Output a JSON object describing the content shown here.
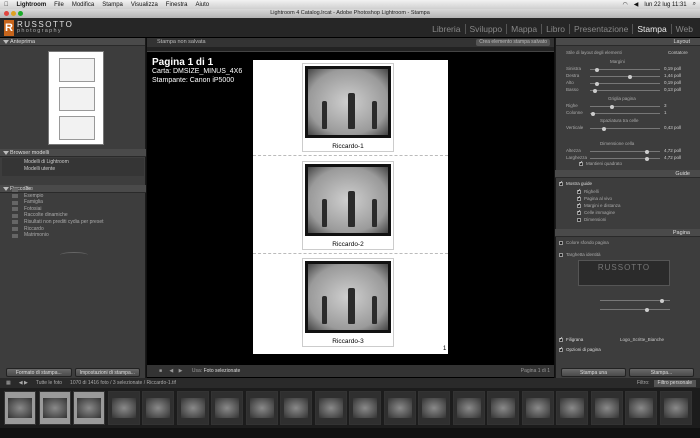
{
  "macbar": {
    "app": "Lightroom",
    "menus": [
      "File",
      "Modifica",
      "Stampa",
      "Visualizza",
      "Finestra",
      "Aiuto"
    ],
    "clock": "lun 22 lug  11:31"
  },
  "window": {
    "title": "Lightroom 4 Catalog.lrcat - Adobe Photoshop Lightroom - Stampa"
  },
  "identity": {
    "brand_letter": "R",
    "brand_name": "RUSSOTTO",
    "brand_sub": "photography"
  },
  "modules": [
    "Libreria",
    "Sviluppo",
    "Mappa",
    "Libro",
    "Presentazione",
    "Stampa",
    "Web"
  ],
  "active_module": "Stampa",
  "left": {
    "preview_header": "Anteprima",
    "template_header": "Browser modelli",
    "templates": [
      "Modelli di Lightroom",
      "Modelli utente"
    ],
    "collections_header": "Raccolte",
    "collections": [
      "Ciro",
      "Esempio",
      "Famiglia",
      "Fotosiai",
      "Raccolte dinamiche",
      "Risultati non prediti cydia per preset",
      "Riccardo",
      "Matrimonio"
    ],
    "page_setup_btn": "Formato di stampa...",
    "print_settings_btn": "Impostazioni di stampa..."
  },
  "center": {
    "unsaved": "Stampa non salvata",
    "create_saved": "Crea elemento stampa salvato",
    "page_title": "Pagina 1 di 1",
    "paper": "Carta: DMSIZE_MINUS_4X6",
    "printer": "Stampante: Canon iP5000",
    "captions": [
      "Riccardo-1",
      "Riccardo-2",
      "Riccardo-3"
    ],
    "page_number": "1",
    "use_label": "Usa:",
    "use_value": "Foto selezionate",
    "page_of": "Pagina 1 di 1"
  },
  "right": {
    "layout_header": "Layout",
    "layout_style_label": "Stile di layout degli elementi",
    "layout_style_value": "Contatore",
    "margins_label": "Margini",
    "margins": [
      {
        "name": "Sinistra",
        "value": "0,19 poll"
      },
      {
        "name": "Destra",
        "value": "1,44 poll"
      },
      {
        "name": "Alto",
        "value": "0,19 poll"
      },
      {
        "name": "Basso",
        "value": "0,13 poll"
      }
    ],
    "grid_label": "Griglia pagina",
    "grid": [
      {
        "name": "Righe",
        "value": "3"
      },
      {
        "name": "Colonne",
        "value": "1"
      }
    ],
    "spacing_label": "Spaziatura tra celle",
    "spacing": [
      {
        "name": "Verticale",
        "value": "0,43 poll"
      }
    ],
    "cell_label": "Dimensione cella",
    "cell": [
      {
        "name": "Altezza",
        "value": "4,72 poll"
      },
      {
        "name": "Larghezza",
        "value": "4,72 poll"
      }
    ],
    "keep_square": "Mantieni quadrato",
    "guides_header": "Guide",
    "show_guides": "Mostra guide",
    "guides": [
      "Righelli",
      "Pagina al vivo",
      "Margini e distanza",
      "Celle immagine",
      "Dimensioni"
    ],
    "page_header": "Pagina",
    "bg_color": "Colore sfondo pagina",
    "identity_plate": "Targhetta identità",
    "watermark": "Filigrana",
    "watermark_value": "Logo_Scritte_Bianche",
    "page_options": "Opzioni di pagina",
    "print_btn": "Stampa una",
    "printer_btn": "Stampa..."
  },
  "filmbar": {
    "source": "Tutte le foto",
    "count": "1070 di 1416 foto / 3 selezionate / Riccardo-1.tif",
    "filter_label": "Filtro:",
    "filter_value": "Filtro personale"
  }
}
